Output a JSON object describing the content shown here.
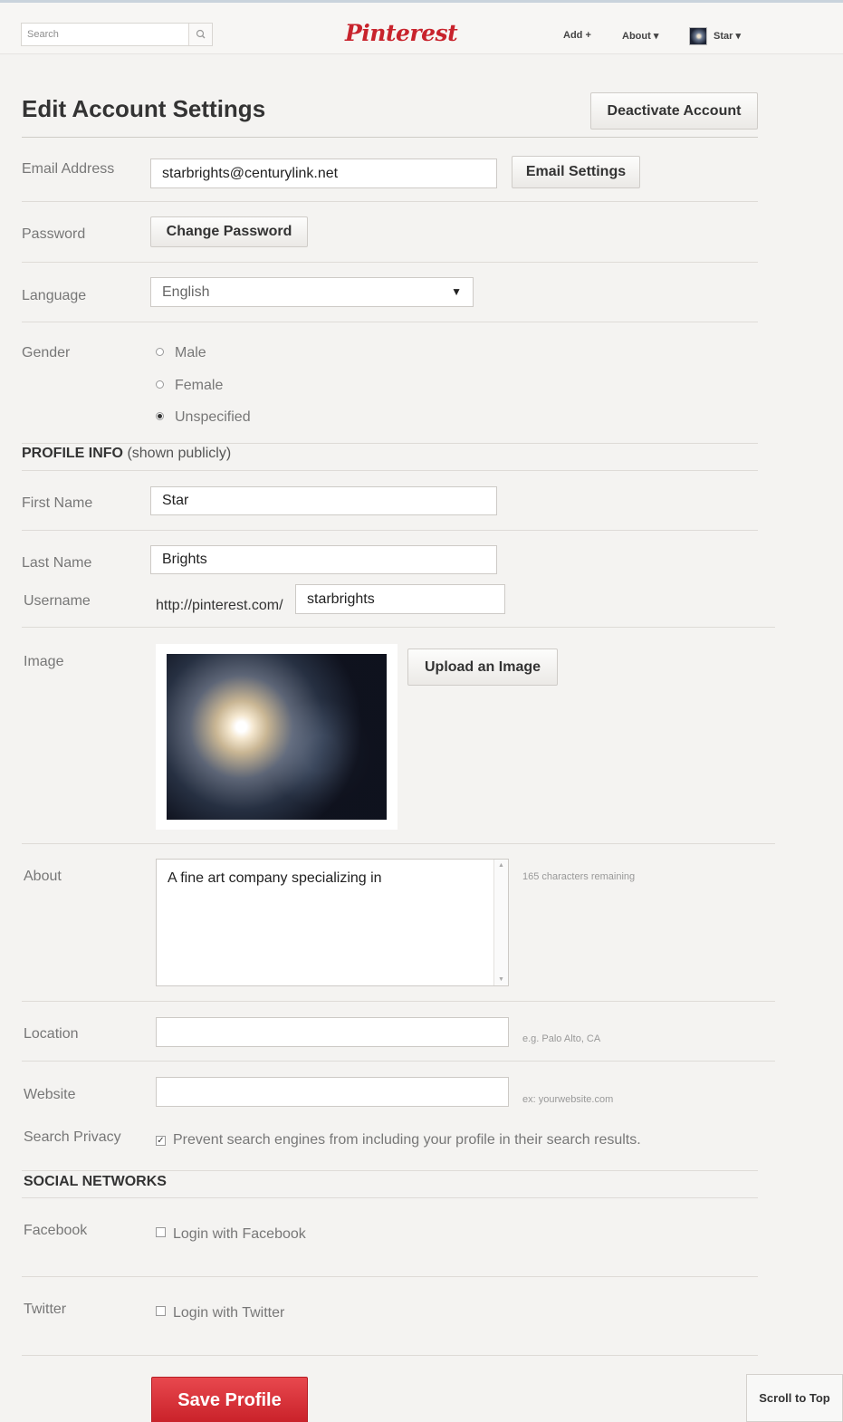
{
  "header": {
    "search_placeholder": "Search",
    "logo": "Pinterest",
    "nav": {
      "add": "Add +",
      "about": "About ▾",
      "user": "Star ▾"
    }
  },
  "page": {
    "title": "Edit Account Settings",
    "deactivate": "Deactivate Account"
  },
  "account": {
    "email_label": "Email Address",
    "email_value": "starbrights@centurylink.net",
    "email_settings": "Email Settings",
    "password_label": "Password",
    "change_password": "Change Password",
    "language_label": "Language",
    "language_value": "English",
    "gender_label": "Gender",
    "gender_options": [
      "Male",
      "Female",
      "Unspecified"
    ],
    "gender_selected": "Unspecified"
  },
  "profile": {
    "heading_bold": "PROFILE INFO",
    "heading_note": " (shown publicly)",
    "first_name_label": "First Name",
    "first_name_value": "Star",
    "last_name_label": "Last Name",
    "last_name_value": "Brights",
    "username_label": "Username",
    "username_prefix": "http://pinterest.com/",
    "username_value": "starbrights",
    "image_label": "Image",
    "upload": "Upload an Image",
    "about_label": "About",
    "about_value": "A fine art company specializing in",
    "about_remaining": "165 characters remaining",
    "location_label": "Location",
    "location_hint": "e.g. Palo Alto, CA",
    "website_label": "Website",
    "website_hint": "ex: yourwebsite.com",
    "privacy_label": "Search Privacy",
    "privacy_text": "Prevent search engines from including your profile in their search results.",
    "privacy_checked": true
  },
  "social": {
    "heading": "SOCIAL NETWORKS",
    "facebook_label": "Facebook",
    "facebook_text": "Login with Facebook",
    "twitter_label": "Twitter",
    "twitter_text": "Login with Twitter"
  },
  "footer": {
    "save": "Save Profile",
    "scroll_top": "Scroll to Top"
  },
  "colors": {
    "brand": "#c8232c",
    "save_button": "#d6353b",
    "background": "#f4f3f1"
  }
}
